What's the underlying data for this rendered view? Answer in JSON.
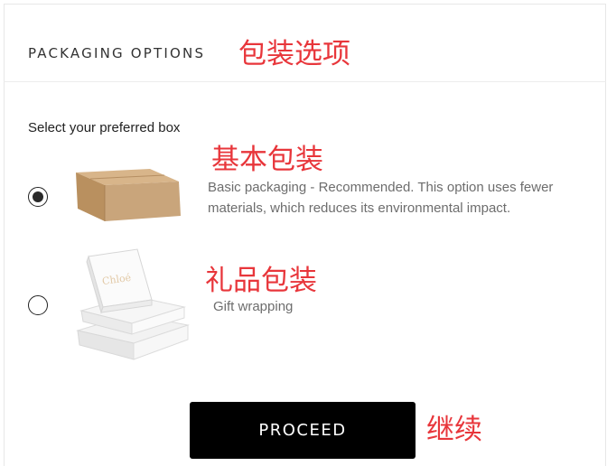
{
  "header": {
    "title": "PACKAGING OPTIONS",
    "title_annotation": "包装选项"
  },
  "prompt": "Select your preferred box",
  "options": [
    {
      "annotation": "基本包装",
      "description_line1": "Basic packaging - Recommended. This option uses fewer",
      "description_line2": "materials, which reduces its environmental impact.",
      "selected": true,
      "icon": "cardboard-box-image"
    },
    {
      "annotation": "礼品包装",
      "description_line1": "Gift wrapping",
      "selected": false,
      "icon": "gift-boxes-image",
      "brand_text": "Chloé"
    }
  ],
  "action": {
    "proceed_label": "PROCEED",
    "proceed_annotation": "继续"
  },
  "colors": {
    "annotation": "#e8363b",
    "button_bg": "#000000",
    "button_text": "#ffffff",
    "box_kraft": "#c9a57b"
  }
}
